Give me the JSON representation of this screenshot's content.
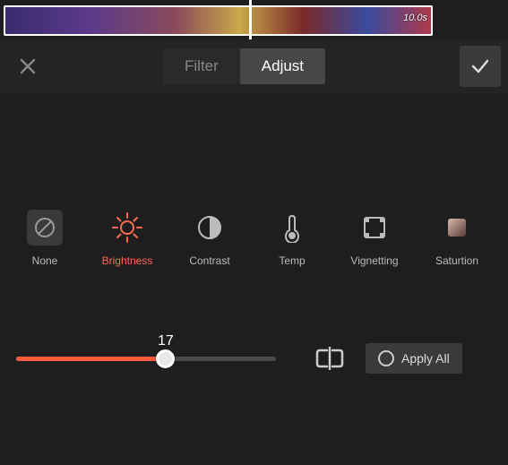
{
  "timeline": {
    "timecode": "10.0s"
  },
  "tabs": {
    "filter": "Filter",
    "adjust": "Adjust",
    "active": "adjust"
  },
  "options": {
    "none": "None",
    "brightness": "Brightness",
    "contrast": "Contrast",
    "temp": "Temp",
    "vignetting": "Vignetting",
    "saturation": "Saturtion",
    "active": "brightness"
  },
  "slider": {
    "value": 17,
    "min": -50,
    "max": 50
  },
  "applyAll": "Apply All",
  "colors": {
    "accent": "#ff6b52",
    "accentFill": "#ff5a3c"
  }
}
